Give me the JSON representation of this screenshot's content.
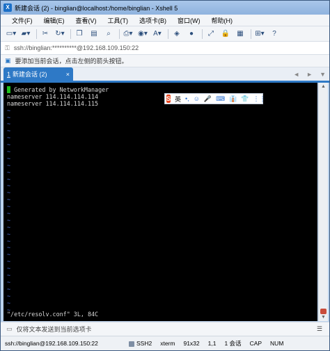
{
  "window": {
    "title": "新建会话 (2) - binglian@localhost:/home/binglian - Xshell 5",
    "app_icon_text": "X"
  },
  "menu": [
    "文件(F)",
    "编辑(E)",
    "查看(V)",
    "工具(T)",
    "选项卡(B)",
    "窗口(W)",
    "帮助(H)"
  ],
  "toolbar_icons": [
    "new-session-icon",
    "open-folder-icon",
    "disconnect-icon",
    "reconnect-icon",
    "copy-icon",
    "paste-icon",
    "find-icon",
    "print-icon",
    "color-scheme-icon",
    "font-icon",
    "fullscreen-icon",
    "lock-icon",
    "new-tab-icon",
    "close-tab-icon",
    "help-icon"
  ],
  "address_bar": {
    "text": "ssh://binglian:**********@192.168.109.150:22"
  },
  "hint_bar": {
    "text": "要添加当前会话，点击左侧的箭头按钮。"
  },
  "tab": {
    "index": "1",
    "label": "新建会话 (2)",
    "close": "×"
  },
  "tab_nav": {
    "prev": "◄",
    "next": "►",
    "menu": "▼"
  },
  "terminal": {
    "lines": [
      {
        "cursor": " ",
        "text": " Generated by NetworkManager"
      },
      {
        "text": "nameserver 114.114.114.114"
      },
      {
        "text": "nameserver 114.114.114.115"
      }
    ],
    "tilde_count": 30,
    "tilde": "~",
    "status_line": "\"/etc/resolv.conf\" 3L, 84C"
  },
  "ime_toolbar": {
    "logo": "S",
    "mode": "英",
    "items": [
      "•,",
      "☺",
      "🎤",
      "⌨",
      "👔",
      "👕",
      "⋮⋮"
    ]
  },
  "send_bar": {
    "text": "仅将文本发送到当前选项卡"
  },
  "status_bar": {
    "connection": "ssh://binglian@192.168.109.150:22",
    "protocol": "SSH2",
    "terminal_type": "xterm",
    "size": "91x32",
    "position": "1,1",
    "sessions": "1 会话",
    "caps": "CAP",
    "num": "NUM"
  },
  "colors": {
    "accent": "#2e79c6",
    "terminal_bg": "#000000",
    "tilde": "#4a6cd3",
    "cursor": "#1ec11e"
  }
}
